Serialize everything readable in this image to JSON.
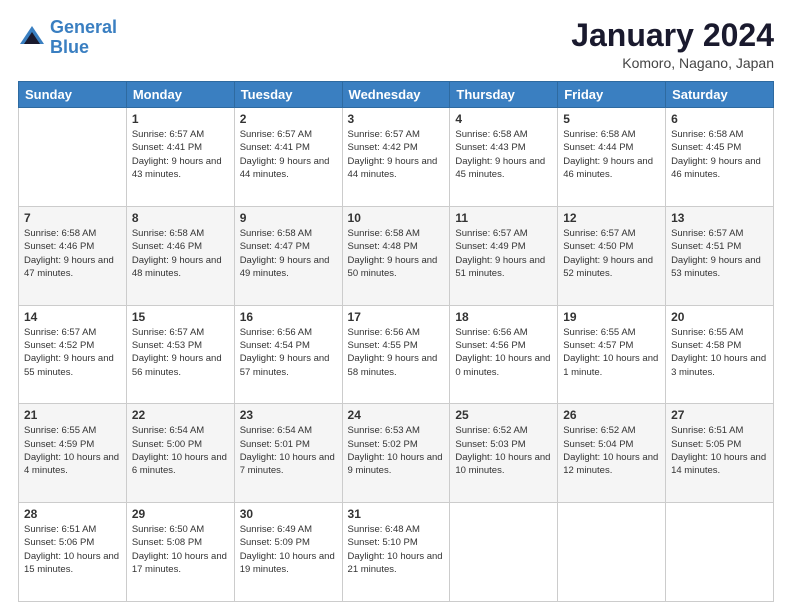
{
  "header": {
    "logo_line1": "General",
    "logo_line2": "Blue",
    "title": "January 2024",
    "subtitle": "Komoro, Nagano, Japan"
  },
  "days_of_week": [
    "Sunday",
    "Monday",
    "Tuesday",
    "Wednesday",
    "Thursday",
    "Friday",
    "Saturday"
  ],
  "weeks": [
    [
      {
        "day": "",
        "sunrise": "",
        "sunset": "",
        "daylight": ""
      },
      {
        "day": "1",
        "sunrise": "Sunrise: 6:57 AM",
        "sunset": "Sunset: 4:41 PM",
        "daylight": "Daylight: 9 hours and 43 minutes."
      },
      {
        "day": "2",
        "sunrise": "Sunrise: 6:57 AM",
        "sunset": "Sunset: 4:41 PM",
        "daylight": "Daylight: 9 hours and 44 minutes."
      },
      {
        "day": "3",
        "sunrise": "Sunrise: 6:57 AM",
        "sunset": "Sunset: 4:42 PM",
        "daylight": "Daylight: 9 hours and 44 minutes."
      },
      {
        "day": "4",
        "sunrise": "Sunrise: 6:58 AM",
        "sunset": "Sunset: 4:43 PM",
        "daylight": "Daylight: 9 hours and 45 minutes."
      },
      {
        "day": "5",
        "sunrise": "Sunrise: 6:58 AM",
        "sunset": "Sunset: 4:44 PM",
        "daylight": "Daylight: 9 hours and 46 minutes."
      },
      {
        "day": "6",
        "sunrise": "Sunrise: 6:58 AM",
        "sunset": "Sunset: 4:45 PM",
        "daylight": "Daylight: 9 hours and 46 minutes."
      }
    ],
    [
      {
        "day": "7",
        "sunrise": "Sunrise: 6:58 AM",
        "sunset": "Sunset: 4:46 PM",
        "daylight": "Daylight: 9 hours and 47 minutes."
      },
      {
        "day": "8",
        "sunrise": "Sunrise: 6:58 AM",
        "sunset": "Sunset: 4:46 PM",
        "daylight": "Daylight: 9 hours and 48 minutes."
      },
      {
        "day": "9",
        "sunrise": "Sunrise: 6:58 AM",
        "sunset": "Sunset: 4:47 PM",
        "daylight": "Daylight: 9 hours and 49 minutes."
      },
      {
        "day": "10",
        "sunrise": "Sunrise: 6:58 AM",
        "sunset": "Sunset: 4:48 PM",
        "daylight": "Daylight: 9 hours and 50 minutes."
      },
      {
        "day": "11",
        "sunrise": "Sunrise: 6:57 AM",
        "sunset": "Sunset: 4:49 PM",
        "daylight": "Daylight: 9 hours and 51 minutes."
      },
      {
        "day": "12",
        "sunrise": "Sunrise: 6:57 AM",
        "sunset": "Sunset: 4:50 PM",
        "daylight": "Daylight: 9 hours and 52 minutes."
      },
      {
        "day": "13",
        "sunrise": "Sunrise: 6:57 AM",
        "sunset": "Sunset: 4:51 PM",
        "daylight": "Daylight: 9 hours and 53 minutes."
      }
    ],
    [
      {
        "day": "14",
        "sunrise": "Sunrise: 6:57 AM",
        "sunset": "Sunset: 4:52 PM",
        "daylight": "Daylight: 9 hours and 55 minutes."
      },
      {
        "day": "15",
        "sunrise": "Sunrise: 6:57 AM",
        "sunset": "Sunset: 4:53 PM",
        "daylight": "Daylight: 9 hours and 56 minutes."
      },
      {
        "day": "16",
        "sunrise": "Sunrise: 6:56 AM",
        "sunset": "Sunset: 4:54 PM",
        "daylight": "Daylight: 9 hours and 57 minutes."
      },
      {
        "day": "17",
        "sunrise": "Sunrise: 6:56 AM",
        "sunset": "Sunset: 4:55 PM",
        "daylight": "Daylight: 9 hours and 58 minutes."
      },
      {
        "day": "18",
        "sunrise": "Sunrise: 6:56 AM",
        "sunset": "Sunset: 4:56 PM",
        "daylight": "Daylight: 10 hours and 0 minutes."
      },
      {
        "day": "19",
        "sunrise": "Sunrise: 6:55 AM",
        "sunset": "Sunset: 4:57 PM",
        "daylight": "Daylight: 10 hours and 1 minute."
      },
      {
        "day": "20",
        "sunrise": "Sunrise: 6:55 AM",
        "sunset": "Sunset: 4:58 PM",
        "daylight": "Daylight: 10 hours and 3 minutes."
      }
    ],
    [
      {
        "day": "21",
        "sunrise": "Sunrise: 6:55 AM",
        "sunset": "Sunset: 4:59 PM",
        "daylight": "Daylight: 10 hours and 4 minutes."
      },
      {
        "day": "22",
        "sunrise": "Sunrise: 6:54 AM",
        "sunset": "Sunset: 5:00 PM",
        "daylight": "Daylight: 10 hours and 6 minutes."
      },
      {
        "day": "23",
        "sunrise": "Sunrise: 6:54 AM",
        "sunset": "Sunset: 5:01 PM",
        "daylight": "Daylight: 10 hours and 7 minutes."
      },
      {
        "day": "24",
        "sunrise": "Sunrise: 6:53 AM",
        "sunset": "Sunset: 5:02 PM",
        "daylight": "Daylight: 10 hours and 9 minutes."
      },
      {
        "day": "25",
        "sunrise": "Sunrise: 6:52 AM",
        "sunset": "Sunset: 5:03 PM",
        "daylight": "Daylight: 10 hours and 10 minutes."
      },
      {
        "day": "26",
        "sunrise": "Sunrise: 6:52 AM",
        "sunset": "Sunset: 5:04 PM",
        "daylight": "Daylight: 10 hours and 12 minutes."
      },
      {
        "day": "27",
        "sunrise": "Sunrise: 6:51 AM",
        "sunset": "Sunset: 5:05 PM",
        "daylight": "Daylight: 10 hours and 14 minutes."
      }
    ],
    [
      {
        "day": "28",
        "sunrise": "Sunrise: 6:51 AM",
        "sunset": "Sunset: 5:06 PM",
        "daylight": "Daylight: 10 hours and 15 minutes."
      },
      {
        "day": "29",
        "sunrise": "Sunrise: 6:50 AM",
        "sunset": "Sunset: 5:08 PM",
        "daylight": "Daylight: 10 hours and 17 minutes."
      },
      {
        "day": "30",
        "sunrise": "Sunrise: 6:49 AM",
        "sunset": "Sunset: 5:09 PM",
        "daylight": "Daylight: 10 hours and 19 minutes."
      },
      {
        "day": "31",
        "sunrise": "Sunrise: 6:48 AM",
        "sunset": "Sunset: 5:10 PM",
        "daylight": "Daylight: 10 hours and 21 minutes."
      },
      {
        "day": "",
        "sunrise": "",
        "sunset": "",
        "daylight": ""
      },
      {
        "day": "",
        "sunrise": "",
        "sunset": "",
        "daylight": ""
      },
      {
        "day": "",
        "sunrise": "",
        "sunset": "",
        "daylight": ""
      }
    ]
  ]
}
